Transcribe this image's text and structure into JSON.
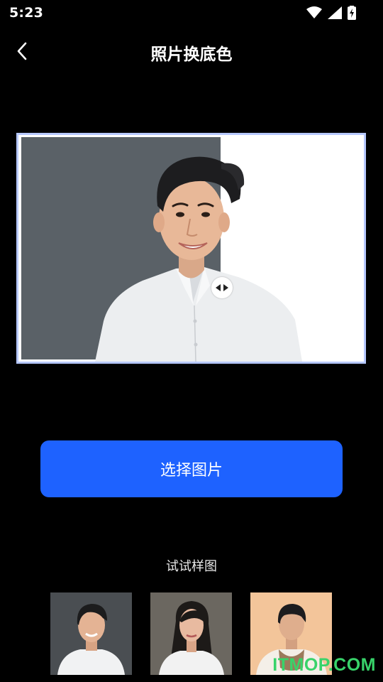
{
  "status": {
    "time": "5:23",
    "icons": [
      "wifi-icon",
      "signal-icon",
      "battery-charging-icon"
    ]
  },
  "header": {
    "title": "照片换底色",
    "back_icon": "chevron-left-icon"
  },
  "preview": {
    "left_bg": "#5a6167",
    "right_bg": "#ffffff",
    "handle_icon": "left-right-arrows-icon",
    "border_color": "#b6c8ff"
  },
  "actions": {
    "select_label": "选择图片",
    "accent": "#1e62ff"
  },
  "samples": {
    "title": "试试样图",
    "items": [
      {
        "bg": "#4a4e52"
      },
      {
        "bg": "#6b6760"
      },
      {
        "bg": "#f3c59a"
      }
    ]
  },
  "watermark": "ITMOP.COM"
}
